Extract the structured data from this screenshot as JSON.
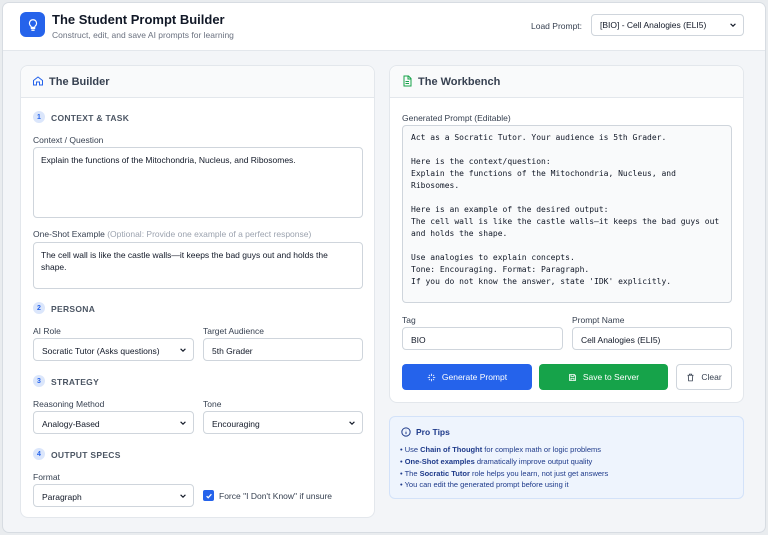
{
  "header": {
    "title": "The Student Prompt Builder",
    "subtitle": "Construct, edit, and save AI prompts for learning",
    "load_label": "Load Prompt:",
    "load_value": "[BIO] - Cell Analogies (ELI5)"
  },
  "builder": {
    "title": "The Builder",
    "sections": {
      "context": {
        "num": "1",
        "title": "CONTEXT & TASK"
      },
      "persona": {
        "num": "2",
        "title": "PERSONA"
      },
      "strategy": {
        "num": "3",
        "title": "STRATEGY"
      },
      "output": {
        "num": "4",
        "title": "OUTPUT SPECS"
      }
    },
    "context_label": "Context / Question",
    "context_value": "Explain the functions of the Mitochondria, Nucleus, and Ribosomes.",
    "oneshot_label": "One-Shot Example",
    "oneshot_hint": "(Optional: Provide one example of a perfect response)",
    "oneshot_value": "The cell wall is like the castle walls—it keeps the bad guys out and holds the shape.",
    "role_label": "AI Role",
    "role_value": "Socratic Tutor (Asks questions)",
    "audience_label": "Target Audience",
    "audience_value": "5th Grader",
    "reasoning_label": "Reasoning Method",
    "reasoning_value": "Analogy-Based",
    "tone_label": "Tone",
    "tone_value": "Encouraging",
    "format_label": "Format",
    "format_value": "Paragraph",
    "idk_label": "Force \"I Don't Know\" if unsure",
    "idk_checked": true
  },
  "workbench": {
    "title": "The Workbench",
    "generated_label": "Generated Prompt (Editable)",
    "generated_text": "Act as a Socratic Tutor. Your audience is 5th Grader.\n\nHere is the context/question:\nExplain the functions of the Mitochondria, Nucleus, and Ribosomes.\n\nHere is an example of the desired output:\nThe cell wall is like the castle walls—it keeps the bad guys out\nand holds the shape.\n\nUse analogies to explain concepts.\nTone: Encouraging. Format: Paragraph.\nIf you do not know the answer, state 'IDK' explicitly.",
    "tag_label": "Tag",
    "tag_value": "BIO",
    "name_label": "Prompt Name",
    "name_value": "Cell Analogies (ELI5)",
    "generate_label": "Generate Prompt",
    "save_label": "Save to Server",
    "clear_label": "Clear"
  },
  "tips": {
    "title": "Pro Tips",
    "items": [
      {
        "pre": "Use ",
        "bold": "Chain of Thought",
        "post": " for complex math or logic problems"
      },
      {
        "pre": "",
        "bold": "One-Shot examples",
        "post": " dramatically improve output quality"
      },
      {
        "pre": "The ",
        "bold": "Socratic Tutor",
        "post": " role helps you learn, not just get answers"
      },
      {
        "pre": "You can edit the generated prompt before using it",
        "bold": "",
        "post": ""
      }
    ]
  },
  "colors": {
    "accent": "#2563eb",
    "success": "#16a34a",
    "tips_bg": "#eef4fd"
  },
  "icons": [
    "lightbulb-icon",
    "chevron-down-icon",
    "home-icon",
    "document-icon",
    "sparkle-icon",
    "save-icon",
    "trash-icon",
    "info-icon",
    "check-icon"
  ]
}
